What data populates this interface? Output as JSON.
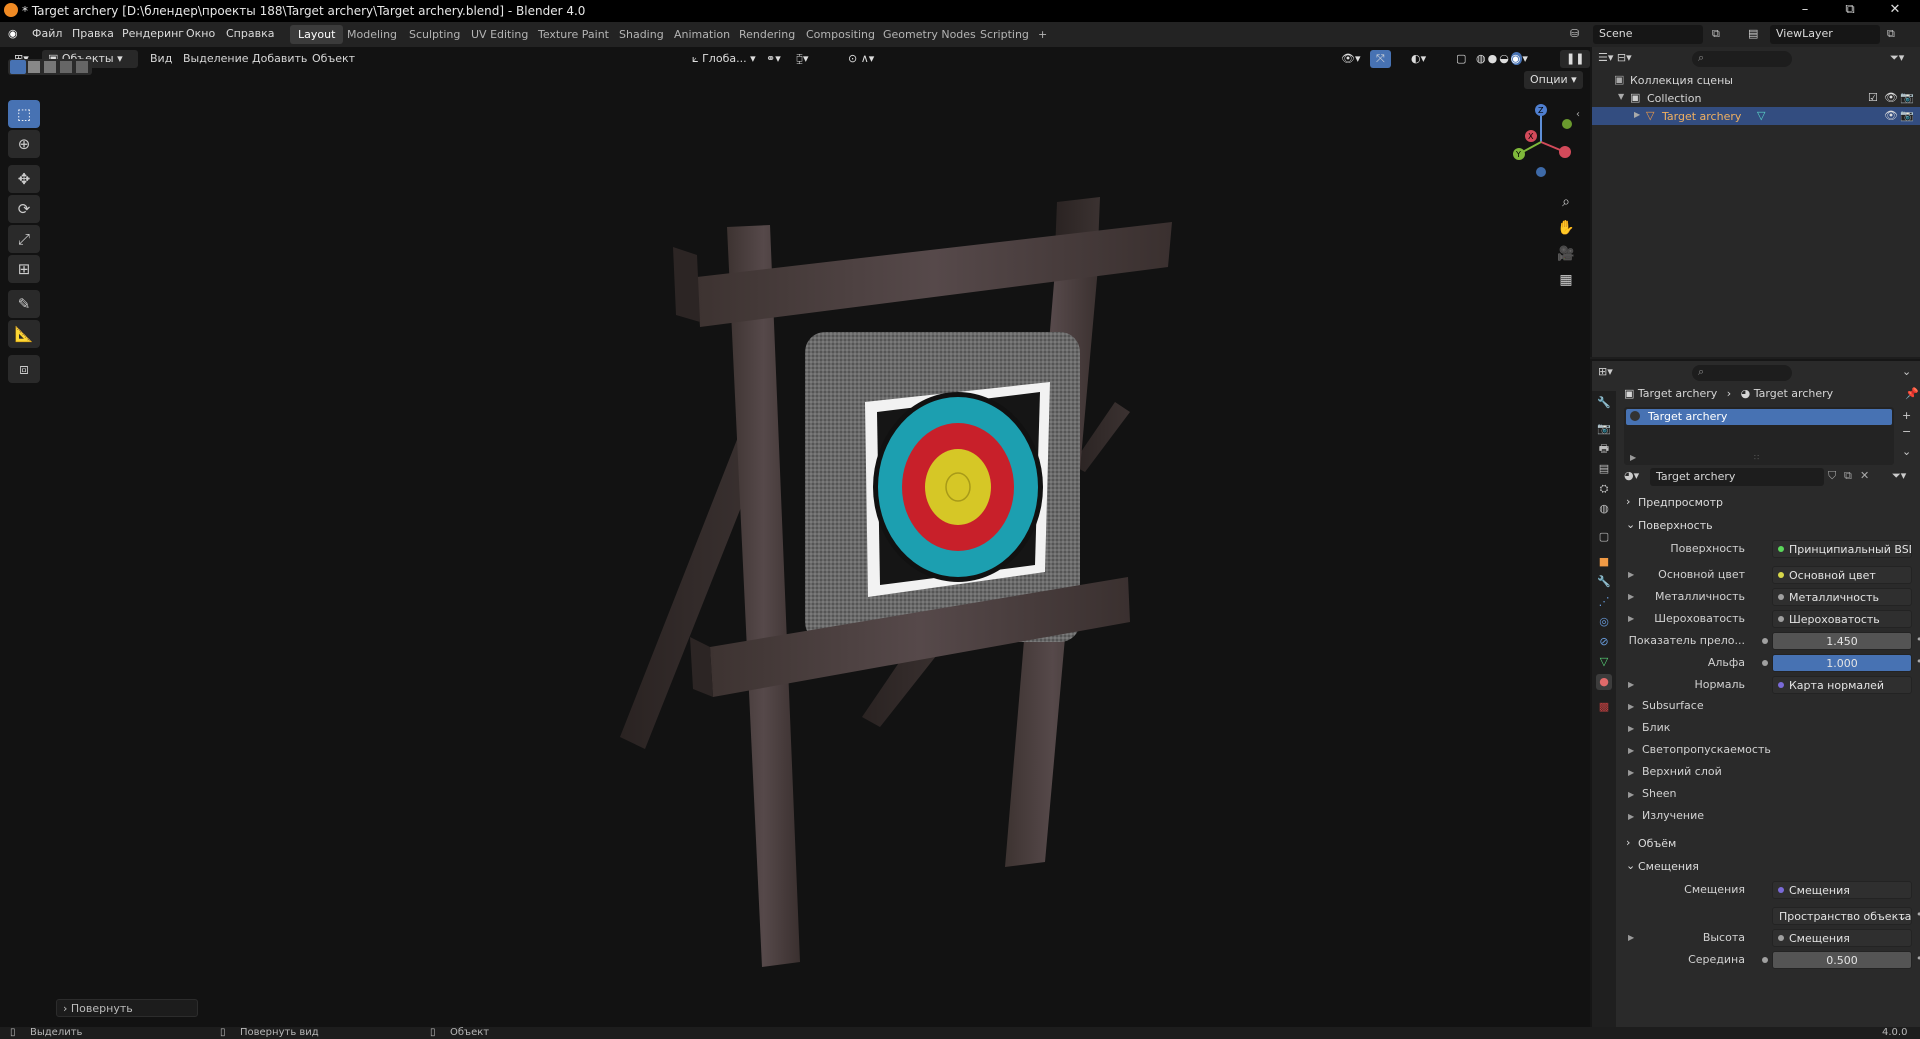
{
  "window": {
    "title": "* Target archery [D:\\блендер\\проекты 188\\Target archery\\Target archery.blend] - Blender 4.0",
    "min": "–",
    "max": "⧉",
    "close": "✕"
  },
  "menus": [
    "Файл",
    "Правка",
    "Рендеринг",
    "Окно",
    "Справка"
  ],
  "workspaces": [
    "Layout",
    "Modeling",
    "Sculpting",
    "UV Editing",
    "Texture Paint",
    "Shading",
    "Animation",
    "Rendering",
    "Compositing",
    "Geometry Nodes",
    "Scripting",
    "+"
  ],
  "active_workspace": "Layout",
  "scene": {
    "name": "Scene",
    "view_layer": "ViewLayer"
  },
  "viewport": {
    "mode": "Объекты",
    "menus": [
      "Вид",
      "Выделение",
      "Добавить",
      "Объект"
    ],
    "transform_orientation": "Глоба...",
    "options_label": "Опции",
    "last_operator": "Повернуть",
    "gizmo_axes": {
      "x": "X",
      "y": "Y",
      "z": "Z"
    }
  },
  "outliner": {
    "root": "Коллекция сцены",
    "collection": "Collection",
    "object": "Target archery"
  },
  "properties": {
    "breadcrumb": [
      "Target archery",
      "Target archery"
    ],
    "material_slot": "Target archery",
    "material_name": "Target archery",
    "sections": {
      "preview": "Предпросмотр",
      "surface": "Поверхность",
      "volume": "Объём",
      "displacement": "Смещения"
    },
    "surface_rows": [
      {
        "label": "Поверхность",
        "value": "Принципиальный BSDF",
        "dot": "#5bd85b",
        "expand": false
      },
      {
        "label": "Основной цвет",
        "value": "Основной цвет",
        "dot": "#d8d84a",
        "expand": true
      },
      {
        "label": "Металличность",
        "value": "Металличность",
        "dot": "#a0a0a0",
        "expand": true
      },
      {
        "label": "Шероховатость",
        "value": "Шероховатость",
        "dot": "#a0a0a0",
        "expand": true
      }
    ],
    "ior_label": "Показатель прело...",
    "ior_value": "1.450",
    "alpha_label": "Альфа",
    "alpha_value": "1.000",
    "normal_label": "Нормаль",
    "normal_value": "Карта нормалей",
    "subpanels": [
      "Subsurface",
      "Блик",
      "Светопропускаемость",
      "Верхний слой",
      "Sheen",
      "Излучение"
    ],
    "displacement_label": "Смещения",
    "displacement_value": "Смещения",
    "space_value": "Пространство объекта",
    "height_label": "Высота",
    "height_value": "Смещения",
    "midlevel_label": "Середина",
    "midlevel_value": "0.500"
  },
  "status": {
    "select": "Выделить",
    "rotate_view": "Повернуть вид",
    "object": "Объект",
    "version": "4.0.0"
  },
  "colors": {
    "accent_blue": "#4772b3",
    "target_white": "#f2f2f2",
    "target_black": "#111111",
    "target_blue": "#1c9fb0",
    "target_red": "#c8202a",
    "target_gold": "#d6c726",
    "wood": "#4a3f3c"
  }
}
